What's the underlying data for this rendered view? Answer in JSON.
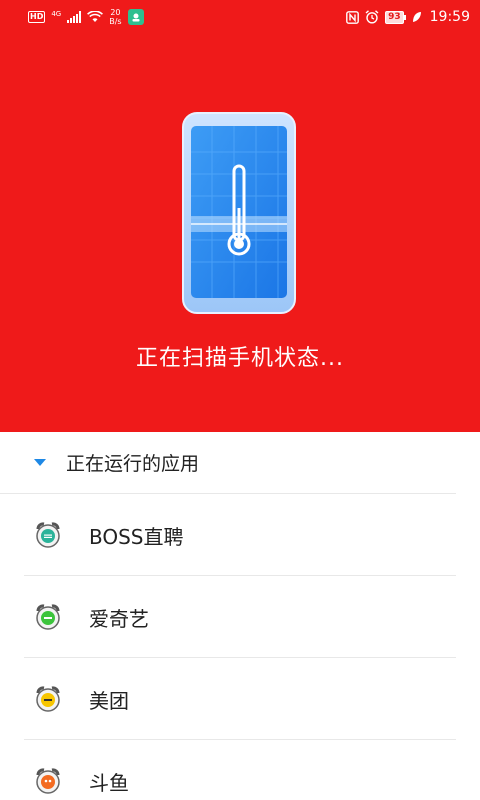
{
  "status_bar": {
    "network_badge": "HD",
    "network_type": "4G",
    "speed_value": "20",
    "speed_unit": "B/s",
    "battery": "93",
    "time": "19:59",
    "icons": [
      "hd-icon",
      "signal-icon",
      "wifi-icon",
      "notification-app-icon",
      "nfc-icon",
      "alarm-icon",
      "battery-icon",
      "charging-leaf-icon"
    ]
  },
  "header": {
    "background_color": "#ef1a1a",
    "scan_text": "正在扫描手机状态...",
    "illustration": "phone-thermometer-icon"
  },
  "running_apps": {
    "section_title": "正在运行的应用",
    "accent_color": "#1e88e5",
    "items": [
      {
        "name": "BOSS直聘",
        "icon": "alarm-clock-app-icon",
        "badge_color": "#2bb39a"
      },
      {
        "name": "爱奇艺",
        "icon": "alarm-clock-app-icon",
        "badge_color": "#3cc43c"
      },
      {
        "name": "美团",
        "icon": "alarm-clock-app-icon",
        "badge_color": "#f7c600"
      },
      {
        "name": "斗鱼",
        "icon": "alarm-clock-app-icon",
        "badge_color": "#f36b21"
      }
    ]
  }
}
